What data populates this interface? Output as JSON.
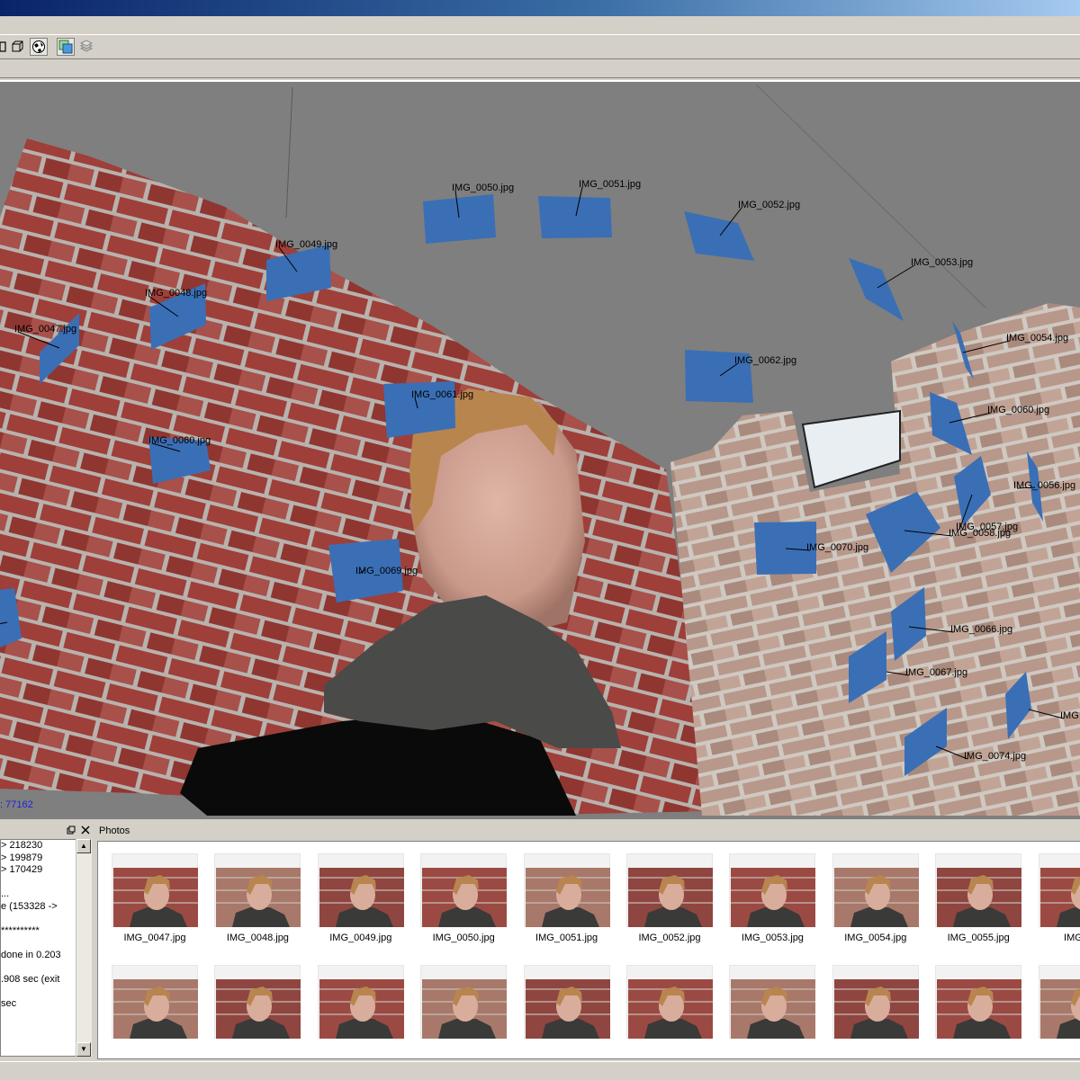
{
  "viewport": {
    "counter": ": 77162",
    "cameras": [
      {
        "label": "IMG_0050.jpg"
      },
      {
        "label": "IMG_0051.jpg"
      },
      {
        "label": "IMG_0052.jpg"
      },
      {
        "label": "IMG_0049.jpg"
      },
      {
        "label": "IMG_0048.jpg"
      },
      {
        "label": "IMG_0047.jpg"
      },
      {
        "label": "IMG_0053.jpg"
      },
      {
        "label": "IMG_0054.jpg"
      },
      {
        "label": "IMG_0062.jpg"
      },
      {
        "label": "IMG_0061.jpg"
      },
      {
        "label": "IMG_0060.jpg"
      },
      {
        "label": "IMG_0069.jpg"
      },
      {
        "label": "IMG_0070.jpg"
      },
      {
        "label": "IMG_0066.jpg"
      },
      {
        "label": "IMG_0067.jpg"
      },
      {
        "label": "IMG_0074.jpg"
      },
      {
        "label": "IMG_0056.jpg"
      },
      {
        "label": "IMG_0057.jpg"
      },
      {
        "label": "IMG_0060.jpg"
      },
      {
        "label": ".jpg"
      },
      {
        "label": "IMG"
      },
      {
        "label": "IMG_0058.jpg"
      }
    ]
  },
  "log": {
    "lines": [
      "> 218230",
      "> 199879",
      "> 170429",
      "",
      "...",
      "e (153328 ->",
      "",
      "**********",
      "",
      "done in 0.203",
      "",
      ".908 sec (exit",
      "",
      "sec"
    ]
  },
  "photos": {
    "title": "Photos",
    "row1": [
      "IMG_0047.jpg",
      "IMG_0048.jpg",
      "IMG_0049.jpg",
      "IMG_0050.jpg",
      "IMG_0051.jpg",
      "IMG_0052.jpg",
      "IMG_0053.jpg",
      "IMG_0054.jpg",
      "IMG_0055.jpg",
      "IMG_00"
    ]
  },
  "colors": {
    "camera_blue": "#3a6fb5",
    "viewport_bg": "#7f7f7f",
    "counter_text": "#2222dd"
  }
}
